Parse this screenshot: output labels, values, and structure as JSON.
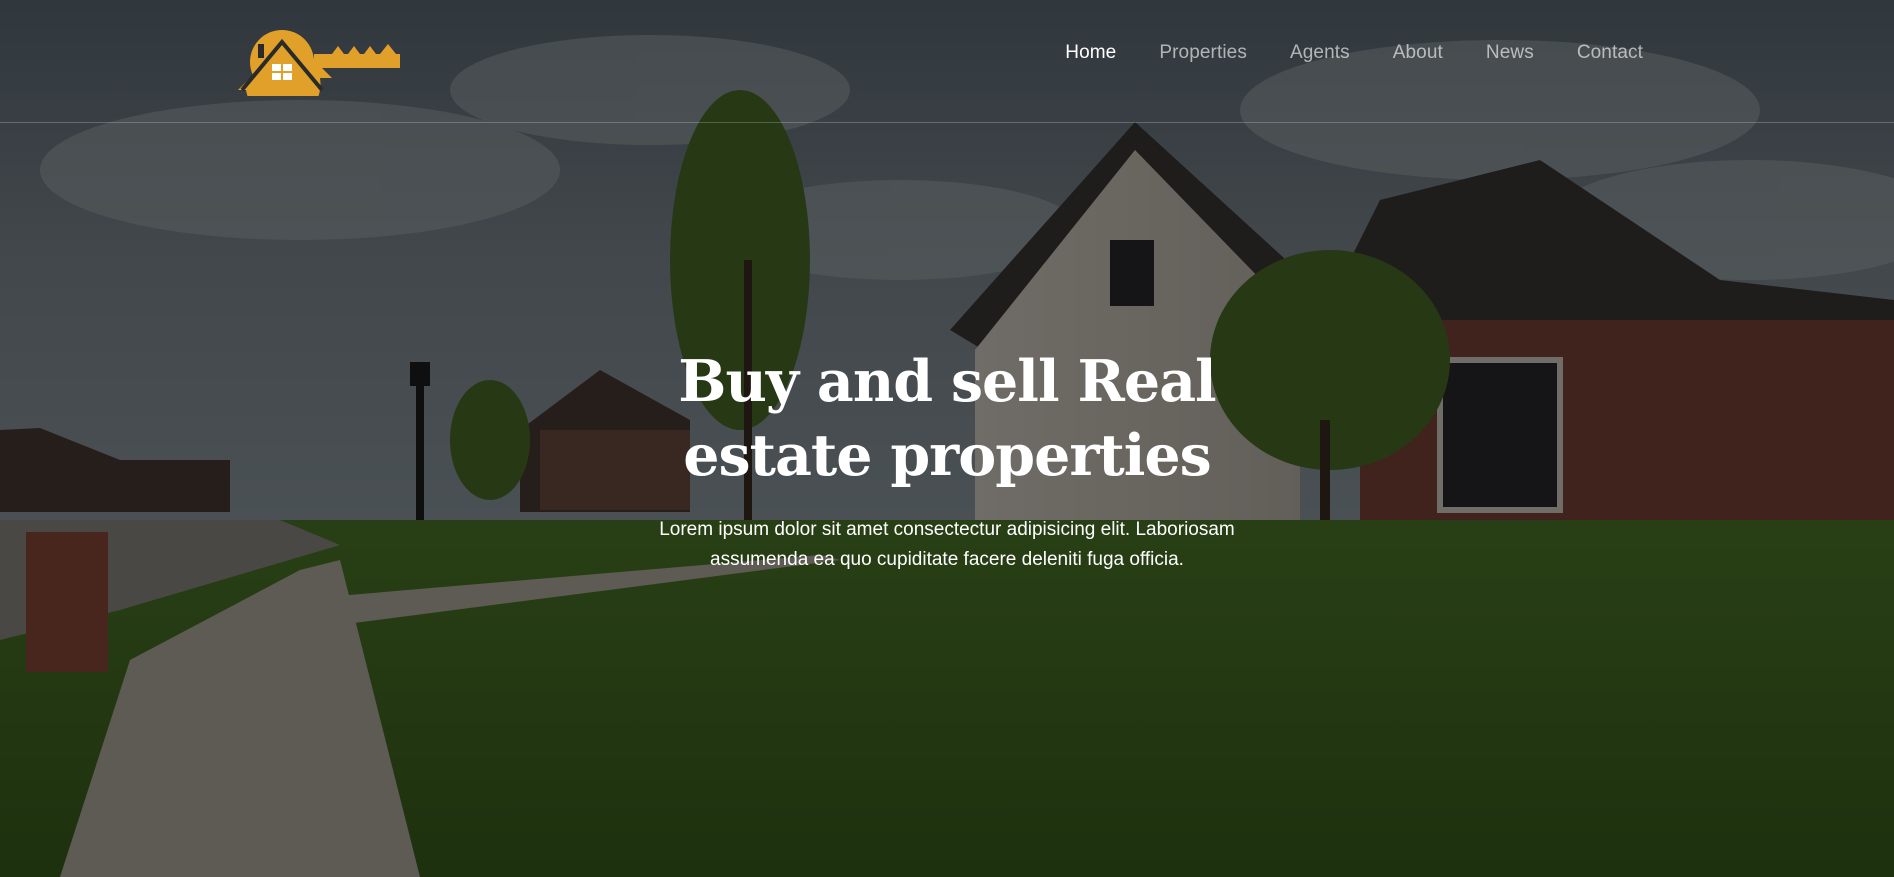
{
  "brand": {
    "logo_icon": "house-key-logo",
    "accent_color": "#e0a02a"
  },
  "nav": {
    "items": [
      {
        "label": "Home",
        "active": true
      },
      {
        "label": "Properties",
        "active": false
      },
      {
        "label": "Agents",
        "active": false
      },
      {
        "label": "About",
        "active": false
      },
      {
        "label": "News",
        "active": false
      },
      {
        "label": "Contact",
        "active": false
      }
    ]
  },
  "hero": {
    "title": "Buy and sell Real estate properties",
    "text": "Lorem ipsum dolor sit amet consectectur adipisicing elit. Laboriosam assumenda ea quo cupiditate facere deleniti fuga officia."
  }
}
